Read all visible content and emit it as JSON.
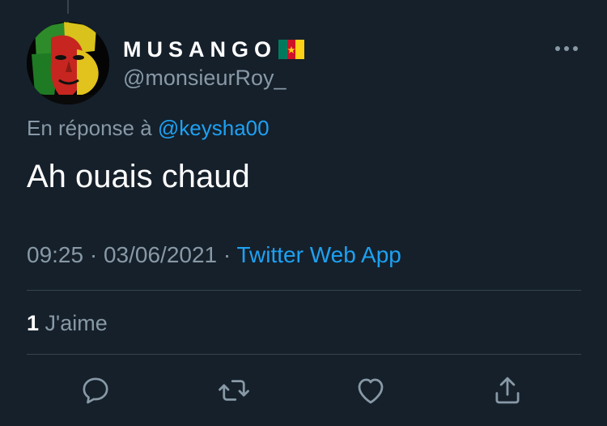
{
  "user": {
    "display_name": "MUSANGO",
    "handle": "@monsieurRoy_",
    "flag_icon": "cameroon-flag-icon"
  },
  "reply": {
    "prefix": "En réponse à",
    "mention": "@keysha00"
  },
  "tweet": {
    "text": "Ah ouais chaud",
    "time": "09:25",
    "date": "03/06/2021",
    "separator": "·",
    "source": "Twitter Web App"
  },
  "engagement": {
    "likes_count": "1",
    "likes_label": "J'aime"
  },
  "actions": [
    {
      "icon": "reply-icon"
    },
    {
      "icon": "retweet-icon"
    },
    {
      "icon": "like-icon"
    },
    {
      "icon": "share-icon"
    }
  ],
  "colors": {
    "background": "#15202b",
    "primary_text": "#ffffff",
    "secondary_text": "#8899a6",
    "accent": "#1da1f2",
    "divider": "#38444d"
  }
}
